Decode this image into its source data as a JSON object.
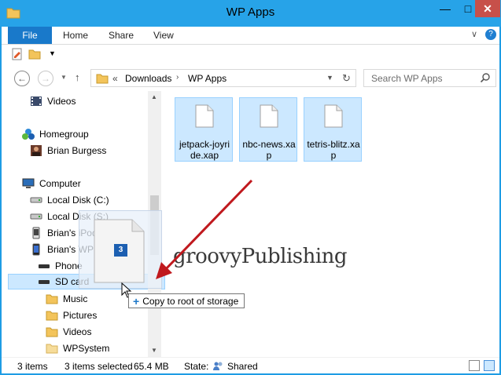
{
  "window": {
    "title": "WP Apps"
  },
  "ribbon": {
    "file": "File",
    "home": "Home",
    "share": "Share",
    "view": "View"
  },
  "address": {
    "chevron": "«",
    "crumbs": [
      "Downloads",
      "WP Apps"
    ],
    "separator": "›"
  },
  "search": {
    "placeholder": "Search WP Apps"
  },
  "nav_items": [
    {
      "label": "Videos",
      "icon": "video-icon"
    },
    {
      "label": "Homegroup",
      "icon": "homegroup-icon"
    },
    {
      "label": "Brian Burgess",
      "icon": "user-photo-icon"
    },
    {
      "label": "Computer",
      "icon": "computer-icon"
    },
    {
      "label": "Local Disk (C:)",
      "icon": "drive-icon"
    },
    {
      "label": "Local Disk (S:)",
      "icon": "drive-icon"
    },
    {
      "label": "Brian's iPod touch",
      "icon": "ipod-icon"
    },
    {
      "label": "Brian's WP8",
      "icon": "phone-icon"
    },
    {
      "label": "Phone",
      "icon": "drive-icon"
    },
    {
      "label": "SD card",
      "icon": "drive-icon"
    },
    {
      "label": "Music",
      "icon": "folder-icon"
    },
    {
      "label": "Pictures",
      "icon": "folder-icon"
    },
    {
      "label": "Videos",
      "icon": "folder-icon"
    },
    {
      "label": "WPSystem",
      "icon": "folder-icon"
    }
  ],
  "files": [
    {
      "name": "jetpack-joyride.xap"
    },
    {
      "name": "nbc-news.xap"
    },
    {
      "name": "tetris-blitz.xap"
    }
  ],
  "drag": {
    "count": "3",
    "tooltip": "Copy to root of storage"
  },
  "watermark": "groovyPublishing",
  "status": {
    "items": "3 items",
    "selected": "3 items selected",
    "size": "65.4 MB",
    "state_label": "State:",
    "state_value": "Shared"
  },
  "colors": {
    "title_bar": "#27a3e8",
    "file_tab": "#1979ca",
    "selection": "#cce8ff",
    "arrow": "#c0191e"
  }
}
